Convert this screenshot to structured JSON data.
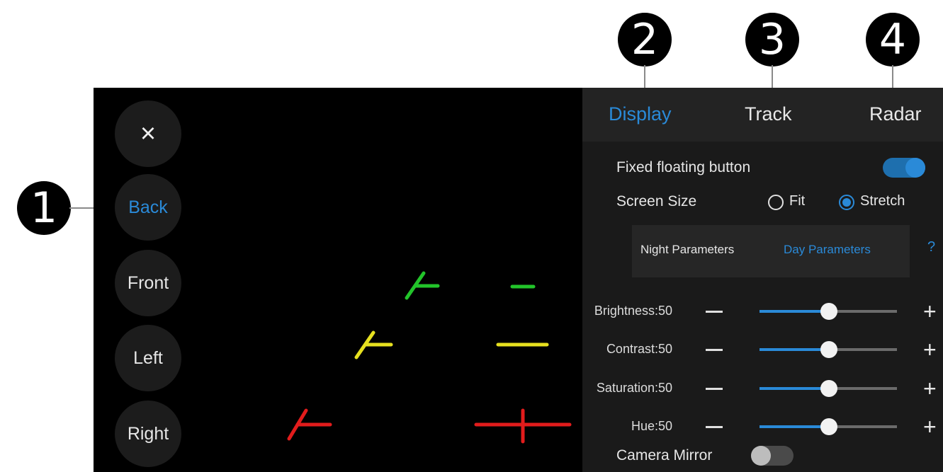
{
  "callouts": [
    "1",
    "2",
    "3",
    "4"
  ],
  "side_buttons": {
    "close_icon": "×",
    "back": "Back",
    "front": "Front",
    "left": "Left",
    "right": "Right"
  },
  "tabs": {
    "display": "Display",
    "track": "Track",
    "radar": "Radar"
  },
  "fixed_floating": {
    "label": "Fixed floating button",
    "on": true
  },
  "screen_size": {
    "label": "Screen Size",
    "fit": "Fit",
    "stretch": "Stretch",
    "selected": "Stretch"
  },
  "parameters": {
    "night": "Night Parameters",
    "day": "Day Parameters",
    "help": "?",
    "active": "Day Parameters"
  },
  "sliders": [
    {
      "label": "Brightness:50",
      "value": 50,
      "minus": "−",
      "plus": "+"
    },
    {
      "label": "Contrast:50",
      "value": 50,
      "minus": "−",
      "plus": "+"
    },
    {
      "label": "Saturation:50",
      "value": 50,
      "minus": "−",
      "plus": "+"
    },
    {
      "label": "Hue:50",
      "value": 50,
      "minus": "−",
      "plus": "+"
    }
  ],
  "camera_mirror": {
    "label": "Camera Mirror",
    "on": false
  },
  "colors": {
    "accent": "#2a8ad8",
    "guide_green": "#22c42a",
    "guide_yellow": "#e6e01f",
    "guide_red": "#e21c1c"
  }
}
